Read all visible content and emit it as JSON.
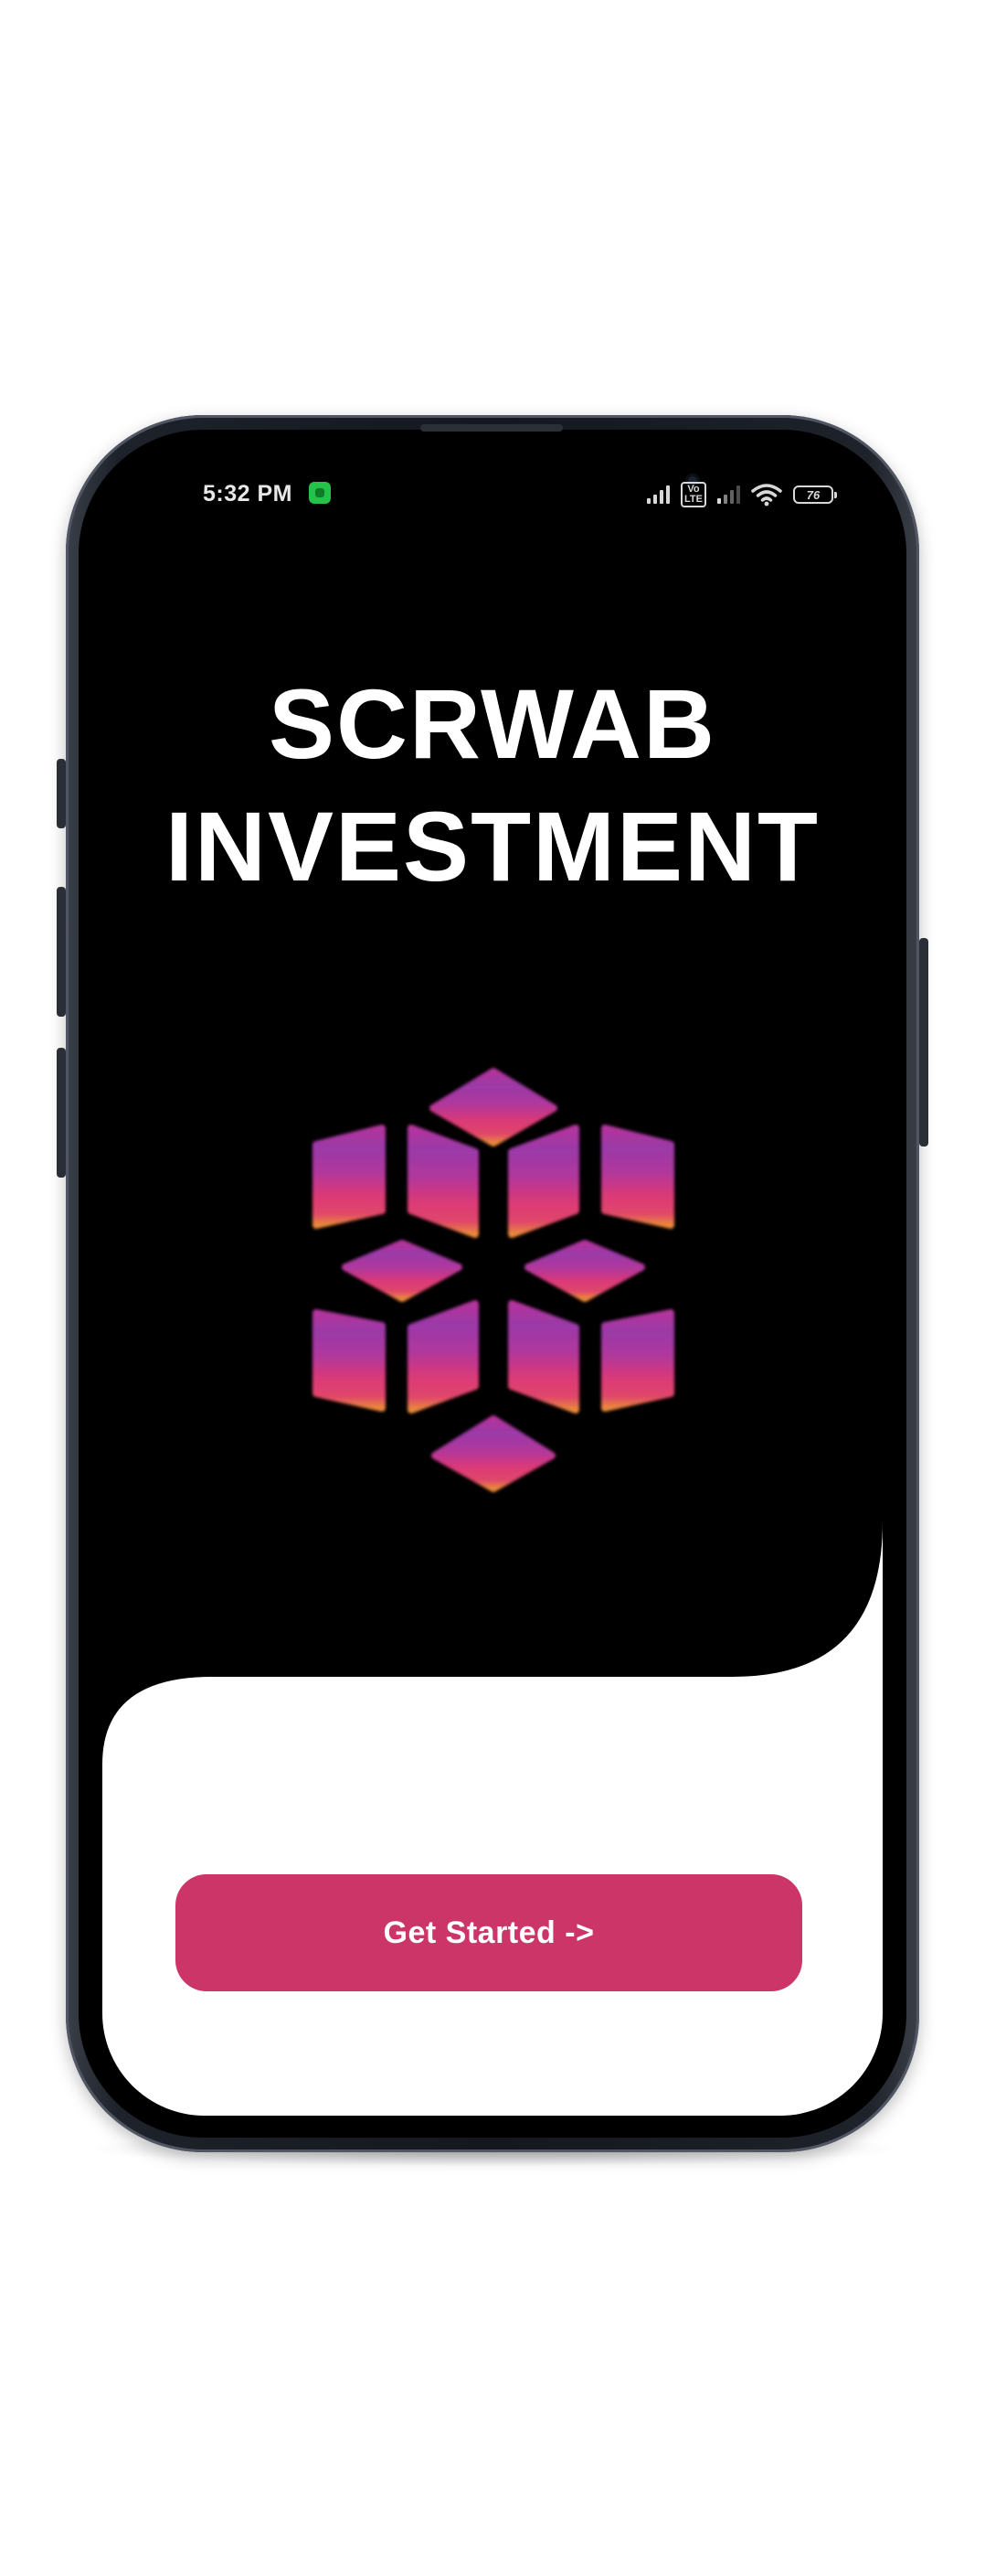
{
  "status_bar": {
    "time": "5:32 PM",
    "volte_label": "Vo\nLTE",
    "battery_level": "76"
  },
  "app": {
    "title_line_1": "SCRWAB",
    "title_line_2": "INVESTMENT",
    "logo_icon": "hexagon-cube-logo-icon",
    "cta_label": "Get Started ->"
  },
  "colors": {
    "background": "#000000",
    "accent": "#cc3567",
    "panel": "#ffffff"
  }
}
